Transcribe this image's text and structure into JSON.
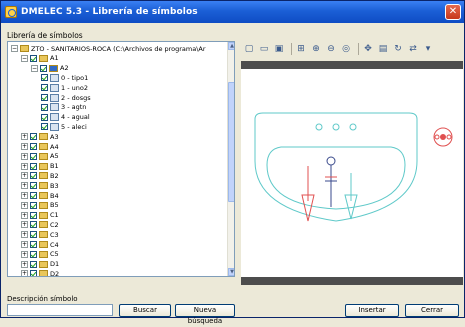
{
  "window": {
    "title": "DMELEC 5.3 - Librería de símbolos"
  },
  "labels": {
    "library": "Librería de símbolos",
    "search": "Descripción símbolo"
  },
  "tree": {
    "root_label": "ZTO - SANITARIOS-ROCA (C:\\Archivos de programa\\Ar",
    "rows": [
      {
        "label": "A1",
        "level": 1,
        "type": "folder",
        "expanded": true
      },
      {
        "label": "A2",
        "level": 2,
        "type": "folder-sel",
        "expanded": true
      },
      {
        "label": "0 - tipo1",
        "level": 3,
        "type": "symbol"
      },
      {
        "label": "1 - uno2",
        "level": 3,
        "type": "symbol"
      },
      {
        "label": "2 - dosgs",
        "level": 3,
        "type": "symbol"
      },
      {
        "label": "3 - agtn",
        "level": 3,
        "type": "symbol"
      },
      {
        "label": "4 - agual",
        "level": 3,
        "type": "symbol"
      },
      {
        "label": "5 - aleci",
        "level": 3,
        "type": "symbol"
      },
      {
        "label": "A3",
        "level": 1,
        "type": "folder"
      },
      {
        "label": "A4",
        "level": 1,
        "type": "folder"
      },
      {
        "label": "A5",
        "level": 1,
        "type": "folder"
      },
      {
        "label": "B1",
        "level": 1,
        "type": "folder"
      },
      {
        "label": "B2",
        "level": 1,
        "type": "folder"
      },
      {
        "label": "B3",
        "level": 1,
        "type": "folder"
      },
      {
        "label": "B4",
        "level": 1,
        "type": "folder"
      },
      {
        "label": "B5",
        "level": 1,
        "type": "folder"
      },
      {
        "label": "C1",
        "level": 1,
        "type": "folder"
      },
      {
        "label": "C2",
        "level": 1,
        "type": "folder"
      },
      {
        "label": "C3",
        "level": 1,
        "type": "folder"
      },
      {
        "label": "C4",
        "level": 1,
        "type": "folder"
      },
      {
        "label": "C5",
        "level": 1,
        "type": "folder"
      },
      {
        "label": "D1",
        "level": 1,
        "type": "folder"
      },
      {
        "label": "D2",
        "level": 1,
        "type": "folder"
      }
    ]
  },
  "buttons": {
    "search": "Buscar",
    "new_search": "Nueva búsqueda",
    "insert": "Insertar",
    "close": "Cerrar"
  },
  "colors": {
    "titlebar": "#1b5fd6",
    "sink_outline": "#5fc9c9",
    "hot_water": "#e05050",
    "cold_water": "#5fc9c9",
    "faucet": "#3a4a8c"
  }
}
